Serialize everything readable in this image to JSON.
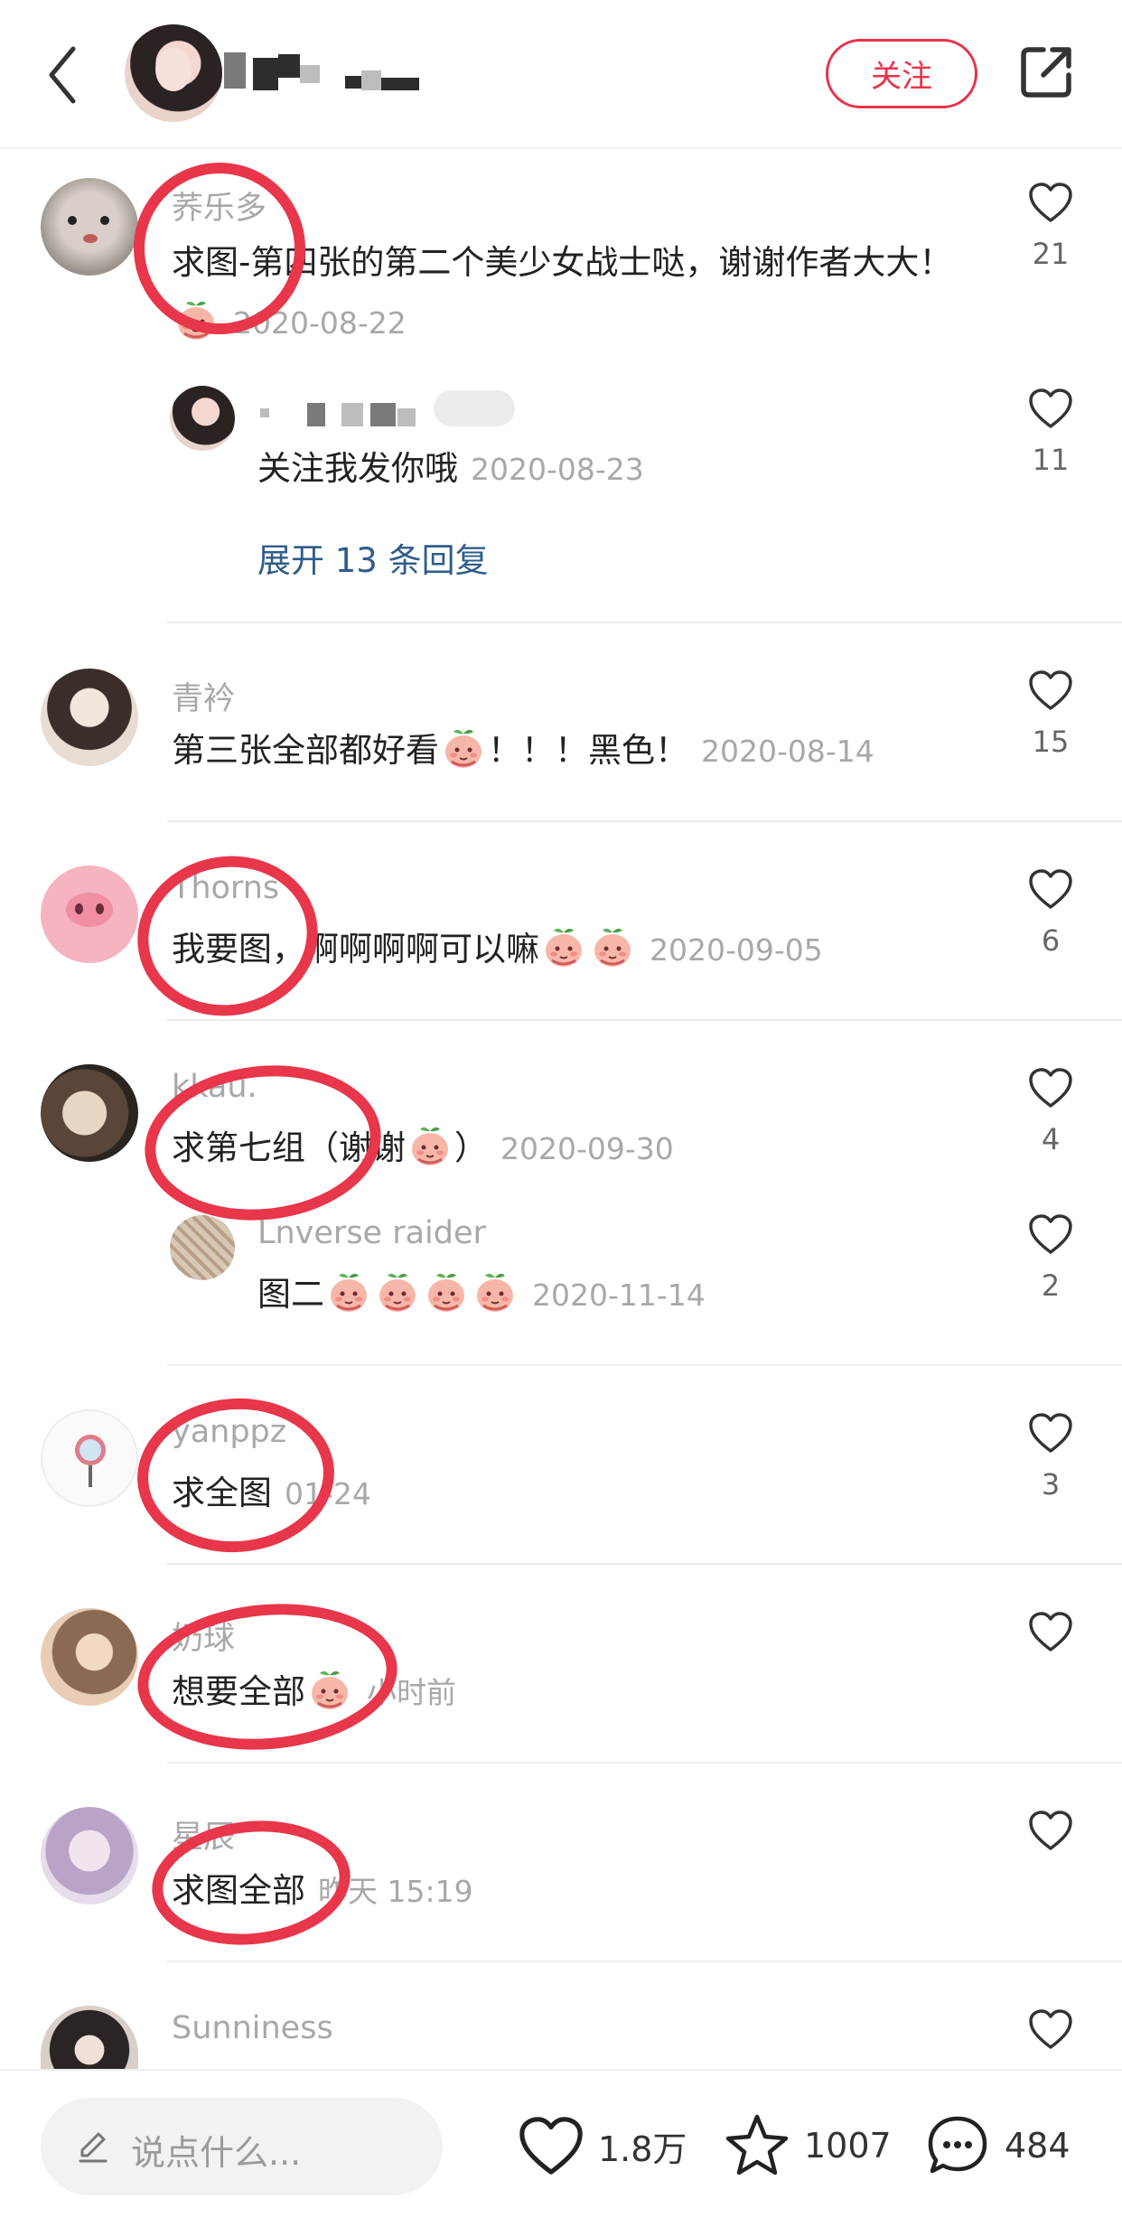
{
  "header": {
    "follow_label": "关注"
  },
  "comments": [
    {
      "username": "荞乐多",
      "text": "求图-第四张的第二个美少女战士哒，谢谢作者大大！",
      "date": "2020-08-22",
      "likes": "21",
      "replies": [
        {
          "text": "关注我发你哦",
          "date": "2020-08-23",
          "likes": "11"
        }
      ],
      "expand_label": "展开 13 条回复"
    },
    {
      "username": "青衿",
      "text": "第三张全部都好看",
      "text2": "！！！黑色！",
      "date": "2020-08-14",
      "likes": "15"
    },
    {
      "username": "Thorns",
      "text": "我要图，啊啊啊啊可以嘛",
      "date": "2020-09-05",
      "likes": "6"
    },
    {
      "username": "kkau.",
      "text": "求第七组（谢谢",
      "text2": "）",
      "date": "2020-09-30",
      "likes": "4",
      "replies": [
        {
          "username": "Lnverse raider",
          "text": "图二",
          "date": "2020-11-14",
          "likes": "2"
        }
      ]
    },
    {
      "username": "yanppz",
      "text": "求全图",
      "date": "01-24",
      "likes": "3"
    },
    {
      "username": "奶球",
      "text": "想要全部",
      "date": "小时前",
      "likes": ""
    },
    {
      "username": "星辰",
      "text": "求图全部",
      "date": "昨天 15:19",
      "likes": ""
    },
    {
      "username": "Sunniness",
      "likes": ""
    }
  ],
  "bottom": {
    "input_placeholder": "说点什么...",
    "likes": "1.8万",
    "favorites": "1007",
    "comments": "484"
  },
  "colors": {
    "accent": "#e8334a",
    "link": "#2f5d8a",
    "muted": "#a8a8a8"
  }
}
